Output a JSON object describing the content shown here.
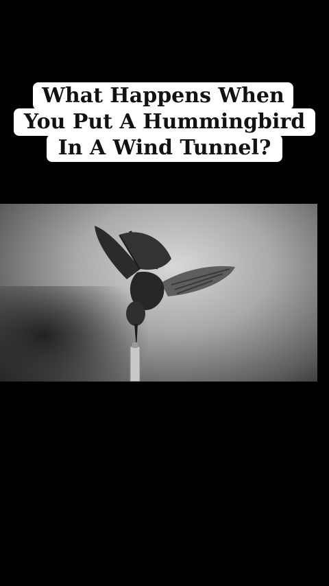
{
  "title": {
    "line1": "What Happens When",
    "line2": "You Put A Hummingbird",
    "line3": "In A Wind Tunnel?"
  },
  "colors": {
    "background": "#000000",
    "caption_bg": "#ffffff",
    "caption_text": "#111111"
  }
}
